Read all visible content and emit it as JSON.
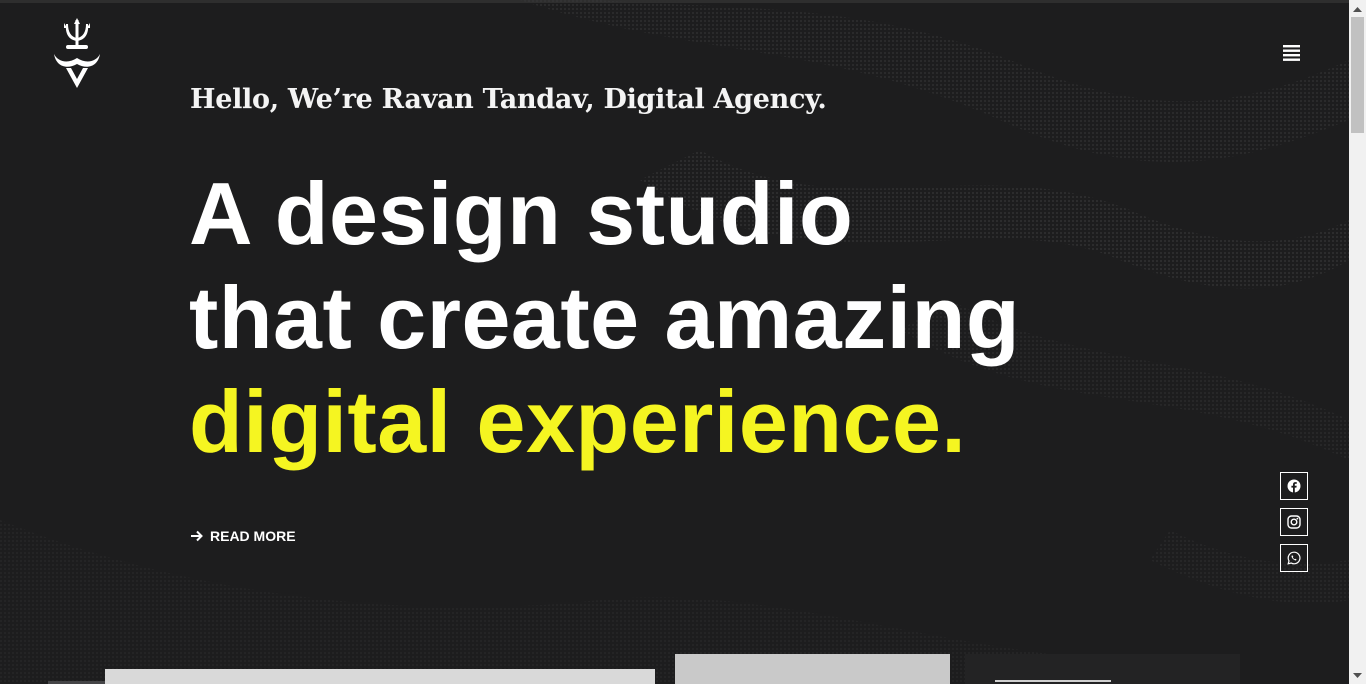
{
  "brand": {
    "logo_icon": "trident-mustache-logo"
  },
  "hero": {
    "greeting": "Hello, We’re Ravan Tandav, Digital Agency.",
    "headline_line1": "A design studio",
    "headline_line2": "that create amazing",
    "headline_line3": "digital experience.",
    "read_more_label": "READ MORE",
    "accent_color": "#f5f521"
  },
  "header": {
    "menu_icon": "hamburger-menu-icon"
  },
  "social": [
    {
      "name": "facebook",
      "icon": "facebook-icon"
    },
    {
      "name": "instagram",
      "icon": "instagram-icon"
    },
    {
      "name": "whatsapp",
      "icon": "whatsapp-icon"
    }
  ],
  "colors": {
    "background": "#1d1d1e",
    "text": "#ffffff",
    "accent": "#f5f521"
  }
}
